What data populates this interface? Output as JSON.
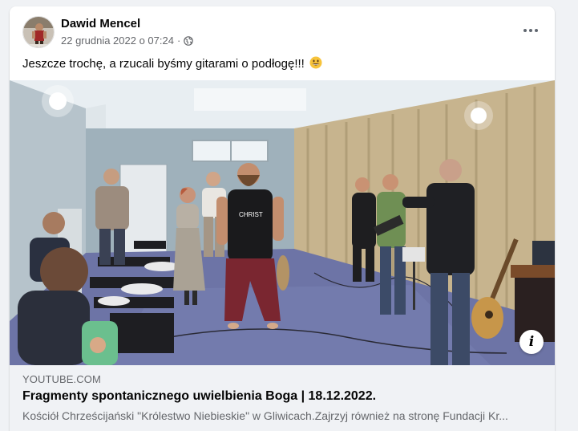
{
  "post": {
    "author": "Dawid Mencel",
    "timestamp": "22 grudnia 2022 o 07:24",
    "separator": "·",
    "privacy_icon": "globe-icon",
    "text": "Jeszcze trochę, a rzucali byśmy gitarami o podłogę!!!",
    "emoji": "grinning-face-emoji",
    "more_icon": "more-options-icon"
  },
  "link_preview": {
    "domain": "YOUTUBE.COM",
    "title": "Fragmenty spontanicznego uwielbienia Boga | 18.12.2022.",
    "description": "Kościół Chrześcijański \"Królestwo Niebieskie\" w Gliwicach.Zajrzyj również na stronę Fundacji Kr...",
    "info_label": "i"
  },
  "colors": {
    "page_bg": "#f0f2f5",
    "card_bg": "#ffffff",
    "secondary_text": "#65676b",
    "primary_text": "#050505"
  }
}
